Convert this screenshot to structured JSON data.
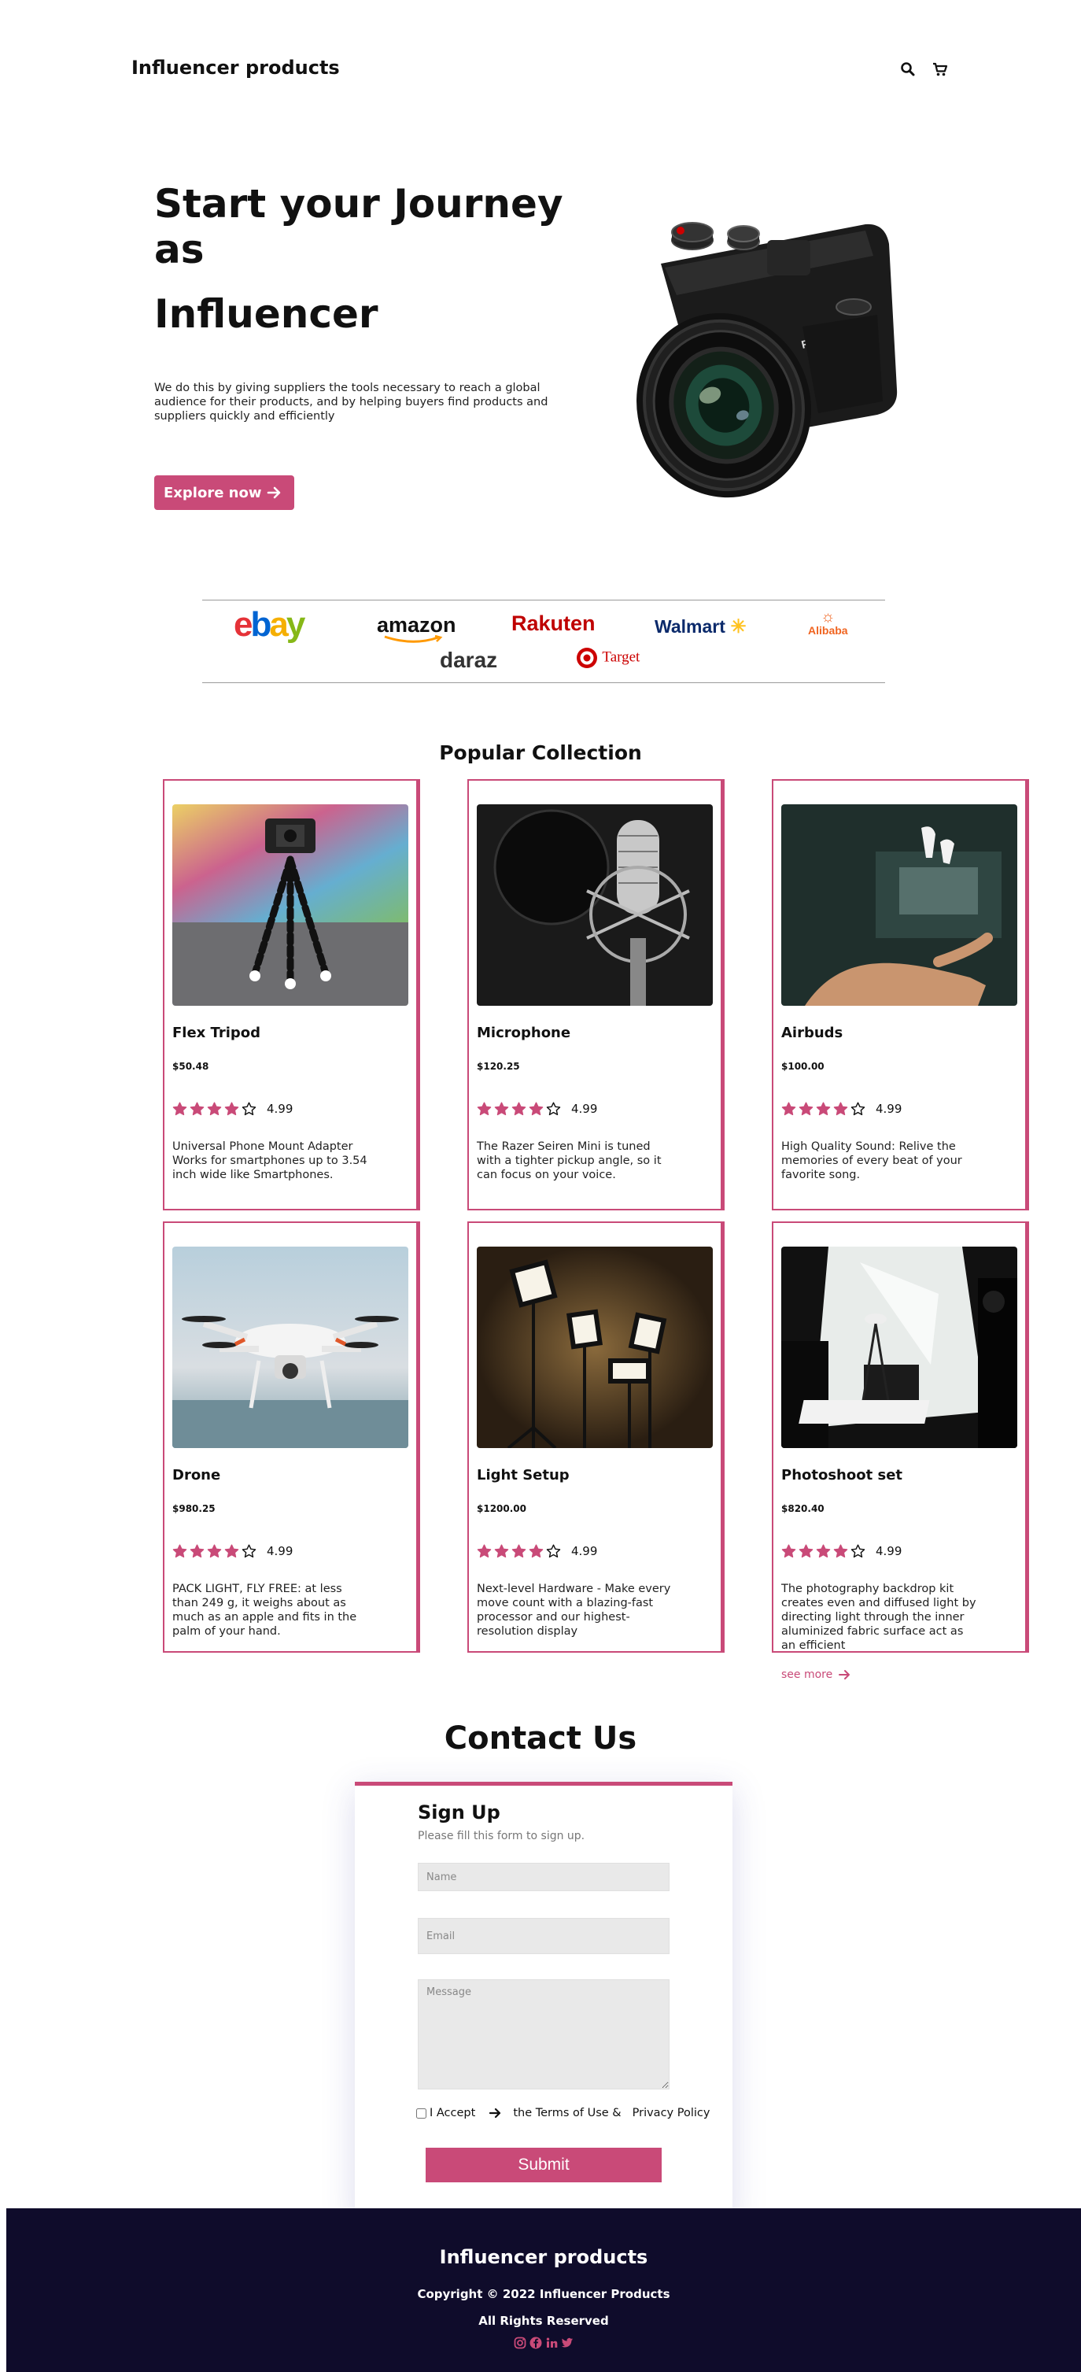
{
  "header": {
    "brand": "Influencer products",
    "icons": [
      "search-icon",
      "cart-icon"
    ]
  },
  "hero": {
    "title_line1": "Start your Journey as",
    "title_line2": "Influencer",
    "description": "We do this by giving suppliers the tools necessary to reach a global audience for their products, and by helping buyers find products and suppliers quickly and efficiently",
    "cta_label": "Explore now",
    "image": "camera"
  },
  "brands": [
    "ebay",
    "amazon",
    "Rakuten",
    "Walmart",
    "Alibaba",
    "daraz",
    "Target"
  ],
  "collection": {
    "title": "Popular Collection",
    "rating_stars": 4,
    "items": [
      {
        "name": "Flex Tripod",
        "price": "$50.48",
        "rating": "4.99",
        "description": "Universal Phone Mount Adapter Works for smartphones up to 3.54 inch wide like Smartphones.",
        "image": "tripod"
      },
      {
        "name": "Microphone",
        "price": "$120.25",
        "rating": "4.99",
        "description": "The Razer Seiren Mini is tuned with a tighter pickup angle, so it can focus on your voice.",
        "image": "microphone"
      },
      {
        "name": "Airbuds",
        "price": "$100.00",
        "rating": "4.99",
        "description": "High Quality Sound: Relive the memories of every beat of your favorite song.",
        "image": "airbuds"
      },
      {
        "name": "Drone",
        "price": "$980.25",
        "rating": "4.99",
        "description": "PACK LIGHT, FLY FREE: at less than 249 g, it weighs about as much as an apple and fits in the palm of your hand.",
        "image": "drone"
      },
      {
        "name": "Light Setup",
        "price": "$1200.00",
        "rating": "4.99",
        "description": "Next-level Hardware - Make every move count with a blazing-fast processor and our highest-resolution display",
        "image": "lights"
      },
      {
        "name": "Photoshoot set",
        "price": "$820.40",
        "rating": "4.99",
        "description": "The photography backdrop kit creates even and diffused light by directing light through the inner aluminized fabric surface act as an efficient",
        "image": "studio"
      }
    ],
    "see_more": "see more"
  },
  "contact": {
    "title": "Contact Us",
    "form_title": "Sign Up",
    "form_subtitle": "Please fill this form to sign up.",
    "name_placeholder": "Name",
    "email_placeholder": "Email",
    "message_placeholder": "Message",
    "accept_label": "I Accept",
    "terms_label": "the Terms of Use &",
    "privacy_label": "Privacy Policy",
    "submit_label": "Submit"
  },
  "footer": {
    "brand": "Influencer products",
    "copyright": "Copyright  ©  2022 Influencer Products",
    "rights": "All Rights Reserved",
    "social_icons": [
      "instagram-icon",
      "facebook-icon",
      "linkedin-icon",
      "twitter-icon"
    ]
  },
  "colors": {
    "accent": "#c94a78",
    "footer_bg": "#0f0c2b"
  }
}
